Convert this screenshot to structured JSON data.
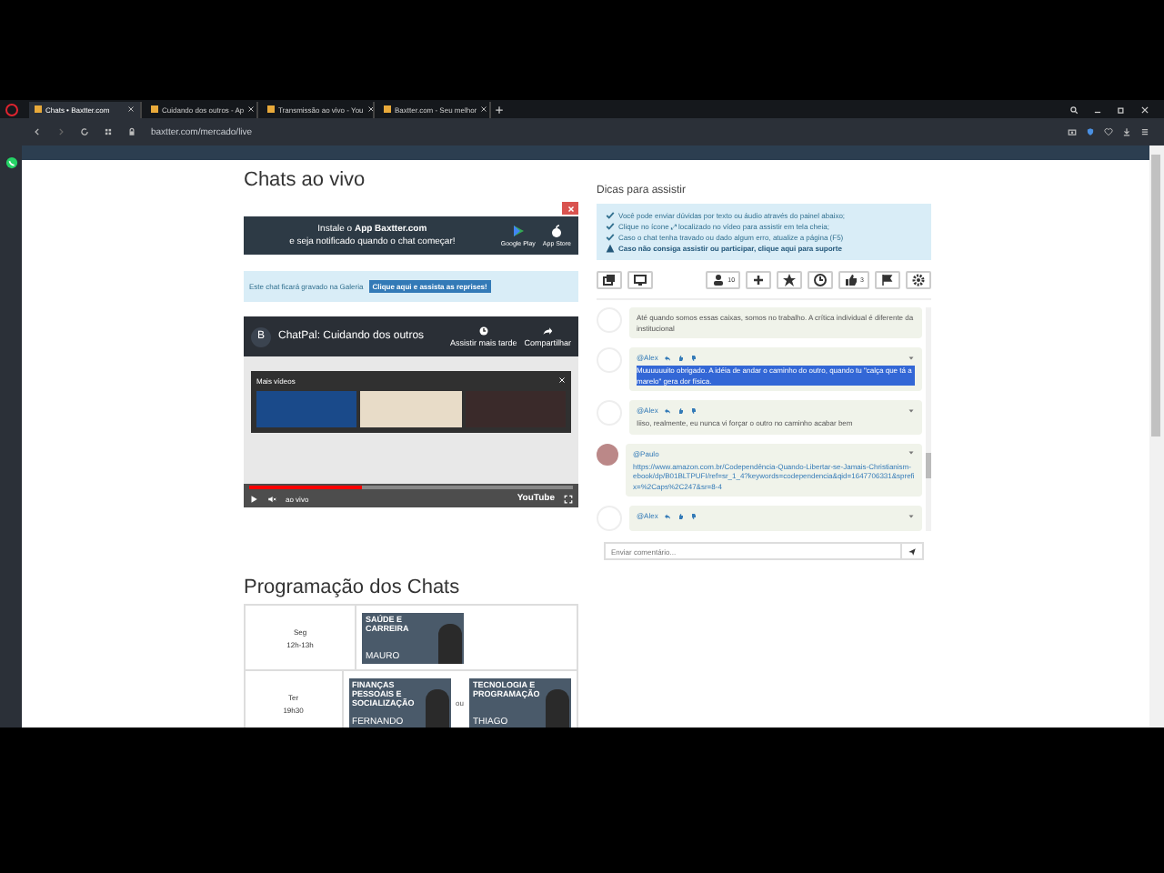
{
  "browser": {
    "tabs": [
      {
        "label": "Chats • Baxtter.com",
        "selected": true
      },
      {
        "label": "Cuidando dos outros - Ap",
        "selected": false
      },
      {
        "label": "Transmissão ao vivo - You",
        "selected": false
      },
      {
        "label": "Baxtter.com - Seu melhor",
        "selected": false
      }
    ],
    "url": "baxtter.com/mercado/live"
  },
  "live": {
    "heading": "Chats ao vivo",
    "app_banner": {
      "line1": "Instale o **App Baxtter.com**",
      "line2": "e seja notificado quando o chat começar!",
      "stores": [
        "Google Play",
        "App Store"
      ]
    },
    "gallery_note": {
      "text": "Este chat ficará gravado na Galeria",
      "button": "Clique aqui e assista as reprises!"
    },
    "video": {
      "channel_initial": "B",
      "title": "ChatPal: Cuidando dos outros",
      "actions": [
        "Assistir mais tarde",
        "Compartilhar"
      ],
      "more_videos": "Mais vídeos",
      "live_label": "ao vivo",
      "brand": "YouTube",
      "progress": {
        "level": 0.35
      }
    }
  },
  "schedule": {
    "heading": "Programação dos Chats",
    "rows": [
      {
        "day": "Seg",
        "time": "12h-13h",
        "hosts": [
          {
            "topic": "SAÚDE E CARREIRA",
            "name": "MAURO"
          }
        ]
      },
      {
        "day": "Ter",
        "time": "19h30",
        "separator": "ou",
        "hosts": [
          {
            "topic": "FINANÇAS PESSOAIS E SOCIALIZAÇÃO",
            "name": "FERNANDO"
          },
          {
            "topic": "TECNOLOGIA E PROGRAMAÇÃO",
            "name": "THIAGO"
          }
        ]
      }
    ]
  },
  "tips": {
    "heading": "Dicas para assistir",
    "items": [
      {
        "kind": "check",
        "text": "Você pode enviar dúvidas por texto ou áudio através do painel abaixo;"
      },
      {
        "kind": "check",
        "text": "Clique no ícone ⤢ localizado no vídeo para assistir em tela cheia;"
      },
      {
        "kind": "check",
        "text": "Caso o chat tenha travado ou dado algum erro, atualize a página (F5)"
      },
      {
        "kind": "warning",
        "text": "Caso não consiga assistir ou participar, clique aqui para suporte"
      }
    ]
  },
  "toolbar": {
    "left": [
      {
        "kind": "windows"
      },
      {
        "kind": "screen"
      }
    ],
    "right": [
      {
        "kind": "users",
        "label": "10"
      },
      {
        "kind": "plus"
      },
      {
        "kind": "star"
      },
      {
        "kind": "clock"
      },
      {
        "kind": "likes",
        "label": "3"
      },
      {
        "kind": "flag-menu"
      },
      {
        "kind": "gear-menu"
      }
    ]
  },
  "messages": [
    {
      "kind": "plain",
      "text": "Até quando somos essas caixas, somos no trabalho. A crítica individual é diferente da institucional",
      "highlighted": false
    },
    {
      "kind": "reply",
      "author": "@Alex",
      "text": "Muuuuuuito obrigado. A idéia de andar o caminho do outro, quando tu \"calça que tá amarelo\" gera dor física.",
      "highlighted": true
    },
    {
      "kind": "reply",
      "author": "@Alex",
      "text": "Iiiso, realmente, eu nunca vi forçar o outro no caminho acabar bem",
      "highlighted": false
    },
    {
      "kind": "link",
      "author": "@Paulo",
      "text": "https://www.amazon.com.br/Codependência-Quando-Libertar-se-Jamais-Christianism-ebook/dp/B01BLTPUFI/ref=sr_1_4?keywords=codependencia&qid=1647706331&sprefix=%2Caps%2C247&sr=8-4",
      "highlighted": false
    },
    {
      "kind": "reply",
      "author": "@Alex"
    }
  ],
  "composer": {
    "placeholder": "Enviar comentário..."
  }
}
